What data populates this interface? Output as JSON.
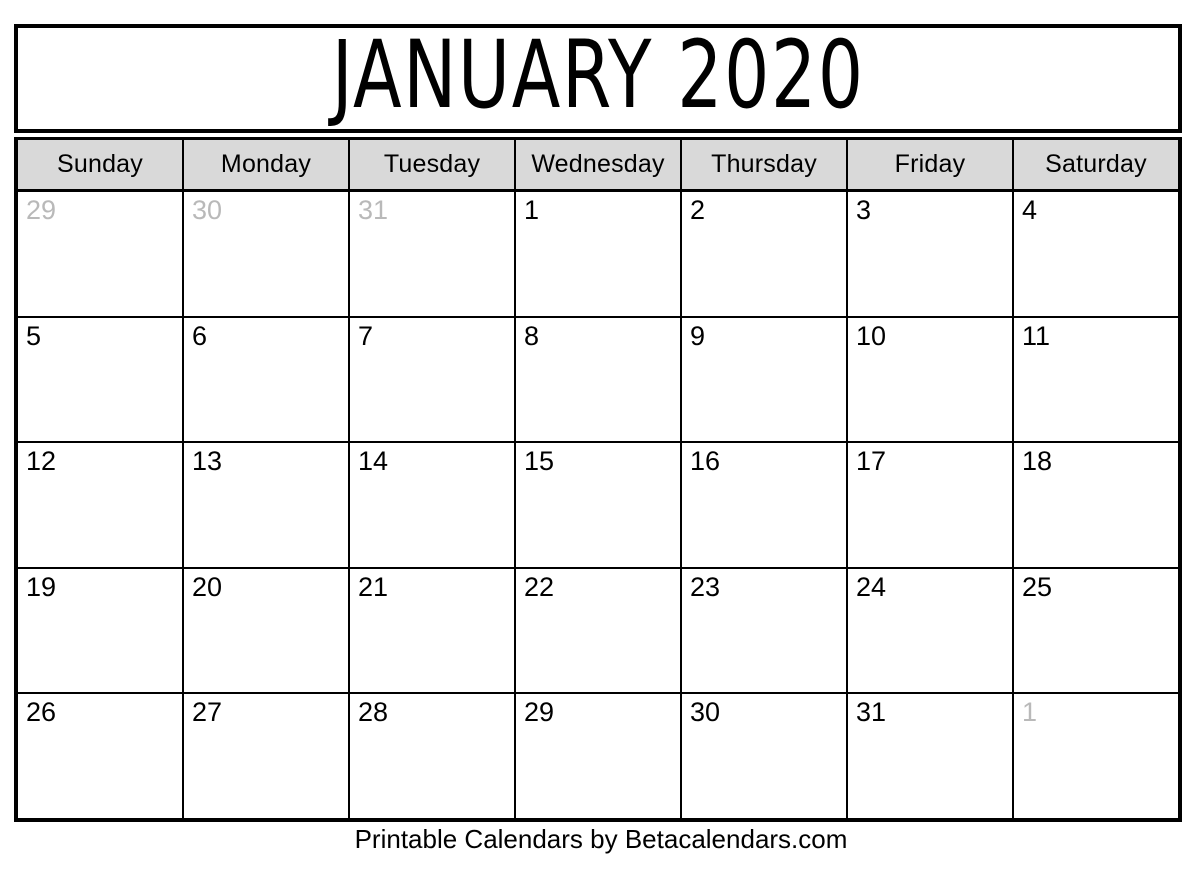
{
  "calendar": {
    "title": "JANUARY 2020",
    "month_name": "January",
    "year": "2020",
    "weekday_headers": [
      "Sunday",
      "Monday",
      "Tuesday",
      "Wednesday",
      "Thursday",
      "Friday",
      "Saturday"
    ],
    "weeks": [
      [
        {
          "label": "29",
          "adjacent": true
        },
        {
          "label": "30",
          "adjacent": true
        },
        {
          "label": "31",
          "adjacent": true
        },
        {
          "label": "1",
          "adjacent": false
        },
        {
          "label": "2",
          "adjacent": false
        },
        {
          "label": "3",
          "adjacent": false
        },
        {
          "label": "4",
          "adjacent": false
        }
      ],
      [
        {
          "label": "5",
          "adjacent": false
        },
        {
          "label": "6",
          "adjacent": false
        },
        {
          "label": "7",
          "adjacent": false
        },
        {
          "label": "8",
          "adjacent": false
        },
        {
          "label": "9",
          "adjacent": false
        },
        {
          "label": "10",
          "adjacent": false
        },
        {
          "label": "11",
          "adjacent": false
        }
      ],
      [
        {
          "label": "12",
          "adjacent": false
        },
        {
          "label": "13",
          "adjacent": false
        },
        {
          "label": "14",
          "adjacent": false
        },
        {
          "label": "15",
          "adjacent": false
        },
        {
          "label": "16",
          "adjacent": false
        },
        {
          "label": "17",
          "adjacent": false
        },
        {
          "label": "18",
          "adjacent": false
        }
      ],
      [
        {
          "label": "19",
          "adjacent": false
        },
        {
          "label": "20",
          "adjacent": false
        },
        {
          "label": "21",
          "adjacent": false
        },
        {
          "label": "22",
          "adjacent": false
        },
        {
          "label": "23",
          "adjacent": false
        },
        {
          "label": "24",
          "adjacent": false
        },
        {
          "label": "25",
          "adjacent": false
        }
      ],
      [
        {
          "label": "26",
          "adjacent": false
        },
        {
          "label": "27",
          "adjacent": false
        },
        {
          "label": "28",
          "adjacent": false
        },
        {
          "label": "29",
          "adjacent": false
        },
        {
          "label": "30",
          "adjacent": false
        },
        {
          "label": "31",
          "adjacent": false
        },
        {
          "label": "1",
          "adjacent": true
        }
      ]
    ]
  },
  "footer": {
    "credit": "Printable Calendars by Betacalendars.com"
  },
  "colors": {
    "border": "#000000",
    "header_background": "#d9d9d9",
    "day_text": "#000000",
    "adjacent_day_text": "#b9b9b9",
    "page_background": "#ffffff"
  }
}
